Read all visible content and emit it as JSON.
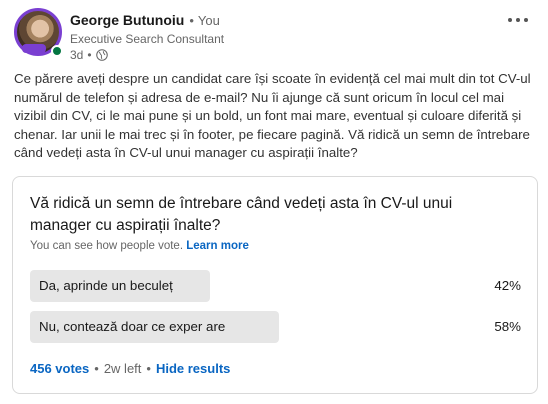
{
  "post": {
    "author": {
      "name": "George Butunoiu",
      "separator": "•",
      "relation": "You",
      "headline": "Executive Search Consultant",
      "time": "3d",
      "meta_separator": "•"
    },
    "icons": {
      "globe": "globe-icon",
      "more": "more-options-icon",
      "avatar": "avatar",
      "status": "online-status-icon"
    },
    "body_text": "Ce părere aveți despre un candidat care își scoate în evidență cel mai mult din tot CV-ul numărul de telefon și adresa de e-mail? Nu îi ajunge că sunt oricum în locul cel mai vizibil din CV, ci le mai pune și un bold, un font mai mare, eventual și culoare diferită și chenar. Iar unii le mai trec și în footer, pe fiecare pagină. Vă ridică un semn de întrebare când vedeți asta în CV-ul unui manager cu aspirații înalte?"
  },
  "poll": {
    "question": "Vă ridică un semn de întrebare când vedeți asta în CV-ul unui manager cu aspirații înalte?",
    "visibility_text": "You can see how people vote.",
    "learn_more": "Learn more",
    "options": [
      {
        "label": "Da, aprinde un beculeț",
        "percent": "42%",
        "share": 0.42
      },
      {
        "label": "Nu, contează doar ce exper are",
        "percent": "58%",
        "share": 0.58
      }
    ],
    "votes": "456 votes",
    "footer_separator": "•",
    "time_left": "2w left",
    "hide_results": "Hide results"
  },
  "colors": {
    "accent": "#0a66c2",
    "bar_fill": "#e6e6e6",
    "online": "#057642",
    "avatar_ring": "#7a3fd1"
  }
}
